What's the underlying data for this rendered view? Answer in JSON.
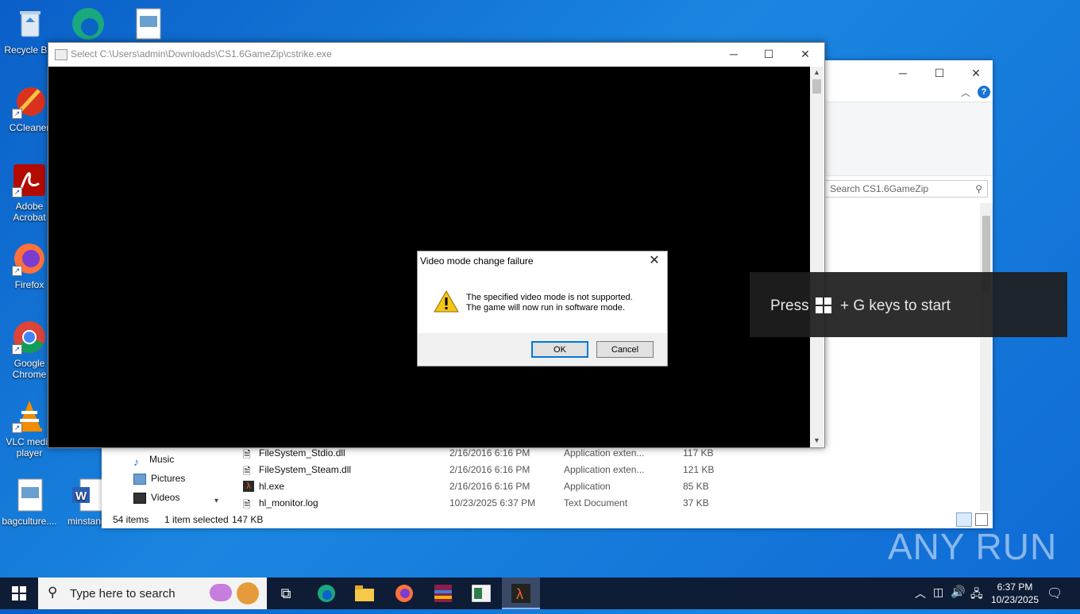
{
  "desktop": {
    "icons": [
      {
        "label": "Recycle Bin",
        "icon": "recycle-bin-icon"
      },
      {
        "label": "CCleaner",
        "icon": "ccleaner-icon"
      },
      {
        "label": "Adobe Acrobat",
        "icon": "acrobat-icon"
      },
      {
        "label": "Firefox",
        "icon": "firefox-icon"
      },
      {
        "label": "Google Chrome",
        "icon": "chrome-icon"
      },
      {
        "label": "VLC media player",
        "icon": "vlc-icon"
      },
      {
        "label": "bagculture....",
        "icon": "image-file-icon"
      },
      {
        "label": "minstanc",
        "icon": "word-file-icon"
      }
    ]
  },
  "explorer": {
    "search_placeholder": "Search CS1.6GameZip",
    "nav_items": [
      "Music",
      "Pictures",
      "Videos"
    ],
    "files": [
      {
        "name": "FileSystem_Stdio.dll",
        "date": "2/16/2016 6:16 PM",
        "type": "Application exten...",
        "size": "117 KB"
      },
      {
        "name": "FileSystem_Steam.dll",
        "date": "2/16/2016 6:16 PM",
        "type": "Application exten...",
        "size": "121 KB"
      },
      {
        "name": "hl.exe",
        "date": "2/16/2016 6:16 PM",
        "type": "Application",
        "size": "85 KB"
      },
      {
        "name": "hl_monitor.log",
        "date": "10/23/2025 6:37 PM",
        "type": "Text Document",
        "size": "37 KB"
      }
    ],
    "status": {
      "items": "54 items",
      "selected": "1 item selected",
      "size": "147 KB"
    }
  },
  "game_window": {
    "title": "Select C:\\Users\\admin\\Downloads\\CS1.6GameZip\\cstrike.exe"
  },
  "dialog": {
    "title": "Video mode change failure",
    "line1": "The specified video mode is not supported.",
    "line2": "The game will now run in software mode.",
    "ok_label": "OK",
    "cancel_label": "Cancel"
  },
  "gamebar_tip": {
    "prefix": "Press",
    "suffix": "+ G keys to start"
  },
  "taskbar": {
    "search_placeholder": "Type here to search",
    "time": "6:37 PM",
    "date": "10/23/2025"
  },
  "watermark": "ANY RUN"
}
